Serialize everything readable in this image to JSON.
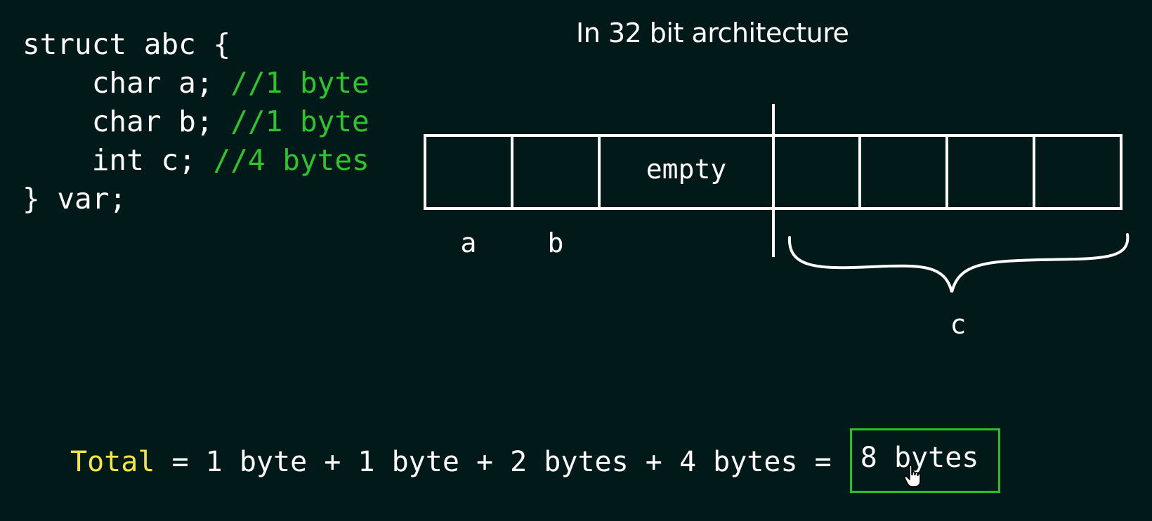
{
  "code": {
    "lines": [
      {
        "code": "struct abc {",
        "comment": ""
      },
      {
        "code": "    char a; ",
        "comment": "//1 byte"
      },
      {
        "code": "    char b; ",
        "comment": "//1 byte"
      },
      {
        "code": "    int c; ",
        "comment": "//4 bytes"
      },
      {
        "code": "} var;",
        "comment": ""
      }
    ]
  },
  "diagram": {
    "title": "In 32 bit architecture",
    "cells": [
      "",
      "",
      "empty",
      "",
      "",
      "",
      ""
    ],
    "labels": {
      "a": "a",
      "b": "b",
      "c": "c"
    }
  },
  "total": {
    "label": "Total",
    "expression": " = 1 byte + 1 byte + 2 bytes + 4 bytes = ",
    "result": "8 bytes"
  },
  "colors": {
    "background": "#011a19",
    "comment": "#2ec42e",
    "total_label": "#f5e642",
    "result_border": "#22c322"
  }
}
